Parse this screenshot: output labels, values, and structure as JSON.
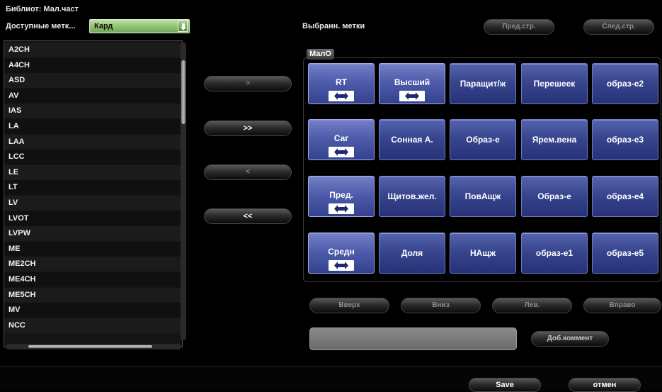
{
  "header": {
    "library_label": "Библиот: Мал.част",
    "available_tags_label": "Доступные метк...",
    "available_tags_value": "Кард",
    "selected_tags_label": "Выбранн. метки"
  },
  "paging": {
    "prev_label": "Пред.стр.",
    "next_label": "След.стр."
  },
  "tag_list": [
    "A2CH",
    "A4CH",
    "ASD",
    "AV",
    "IAS",
    "LA",
    "LAA",
    "LCC",
    "LE",
    "LT",
    "LV",
    "LVOT",
    "LVPW",
    "ME",
    "ME2CH",
    "ME4CH",
    "ME5CH",
    "MV",
    "NCC"
  ],
  "transfer": {
    "add_one": ">",
    "add_all": ">>",
    "remove_one": "<",
    "remove_all": "<<"
  },
  "group": {
    "name": "МалО",
    "tags": [
      {
        "name": "RT",
        "icon": "swap-arrows-icon"
      },
      {
        "name": "Высший",
        "icon": "swap-arrows-icon"
      },
      {
        "name": "Паращит/ж"
      },
      {
        "name": "Перешеек"
      },
      {
        "name": "образ-е2"
      },
      {
        "name": "Саг",
        "icon": "swap-arrows-icon"
      },
      {
        "name": "Сонная А."
      },
      {
        "name": "Образ-е"
      },
      {
        "name": "Ярем.вена"
      },
      {
        "name": "образ-е3"
      },
      {
        "name": "Пред.",
        "icon": "swap-arrows-icon"
      },
      {
        "name": "Щитов.жел."
      },
      {
        "name": "ПовАщж"
      },
      {
        "name": "Образ-е"
      },
      {
        "name": "образ-е4"
      },
      {
        "name": "Средн",
        "icon": "swap-arrows-icon"
      },
      {
        "name": "Доля"
      },
      {
        "name": "НАщж"
      },
      {
        "name": "образ-е1"
      },
      {
        "name": "образ-е5"
      }
    ]
  },
  "move": {
    "up": "Вверх",
    "down": "Вниз",
    "left": "Лев.",
    "right": "Вправо"
  },
  "comment": {
    "value": "",
    "add_label": "Доб.коммент"
  },
  "footer": {
    "save_label": "Save",
    "cancel_label": "отмен"
  },
  "colors": {
    "tag_blue": "#38468f",
    "dropdown_green": "#8fc070",
    "background": "#000000"
  }
}
